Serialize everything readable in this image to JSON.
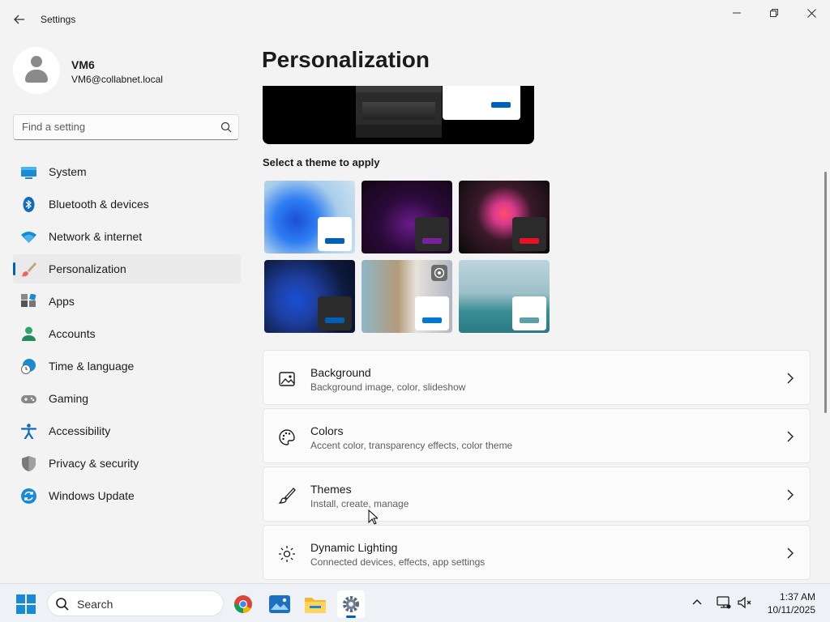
{
  "window": {
    "title": "Settings",
    "controls": {
      "minimize": "—",
      "maximize": "❐",
      "close": "✕"
    }
  },
  "profile": {
    "name": "VM6",
    "email": "VM6@collabnet.local"
  },
  "search": {
    "placeholder": "Find a setting"
  },
  "nav": {
    "items": [
      {
        "label": "System",
        "icon": "monitor-icon"
      },
      {
        "label": "Bluetooth & devices",
        "icon": "bluetooth-icon"
      },
      {
        "label": "Network & internet",
        "icon": "wifi-icon"
      },
      {
        "label": "Personalization",
        "icon": "paintbrush-icon",
        "active": true
      },
      {
        "label": "Apps",
        "icon": "apps-icon"
      },
      {
        "label": "Accounts",
        "icon": "person-icon"
      },
      {
        "label": "Time & language",
        "icon": "globe-clock-icon"
      },
      {
        "label": "Gaming",
        "icon": "gamepad-icon"
      },
      {
        "label": "Accessibility",
        "icon": "accessibility-icon"
      },
      {
        "label": "Privacy & security",
        "icon": "shield-icon"
      },
      {
        "label": "Windows Update",
        "icon": "update-icon"
      }
    ]
  },
  "page": {
    "title": "Personalization",
    "theme_section_label": "Select a theme to apply",
    "themes": [
      {
        "name": "windows-light",
        "accent": "#005fb8",
        "card": "#ffffff"
      },
      {
        "name": "glow",
        "accent": "#7a1fa2",
        "card": "#2b2b2b"
      },
      {
        "name": "captured-motion",
        "accent": "#e81123",
        "card": "#2b2b2b"
      },
      {
        "name": "windows-dark",
        "accent": "#005fb8",
        "card": "#2b2b2b"
      },
      {
        "name": "spotlight",
        "accent": "#0078d4",
        "card": "#ffffff"
      },
      {
        "name": "flow",
        "accent": "#5aa0a8",
        "card": "#ffffff"
      }
    ],
    "settings": [
      {
        "title": "Background",
        "subtitle": "Background image, color, slideshow",
        "icon": "image-icon"
      },
      {
        "title": "Colors",
        "subtitle": "Accent color, transparency effects, color theme",
        "icon": "palette-icon"
      },
      {
        "title": "Themes",
        "subtitle": "Install, create, manage",
        "icon": "brush-icon"
      },
      {
        "title": "Dynamic Lighting",
        "subtitle": "Connected devices, effects, app settings",
        "icon": "sun-icon"
      }
    ]
  },
  "taskbar": {
    "search_label": "Search",
    "apps": [
      "chrome-icon",
      "photos-icon",
      "file-explorer-icon",
      "settings-icon"
    ],
    "time": "1:37 AM",
    "date": "10/11/2025"
  },
  "colors": {
    "accent": "#005fb8",
    "background": "#f3f3f3",
    "card": "#fbfbfb"
  }
}
